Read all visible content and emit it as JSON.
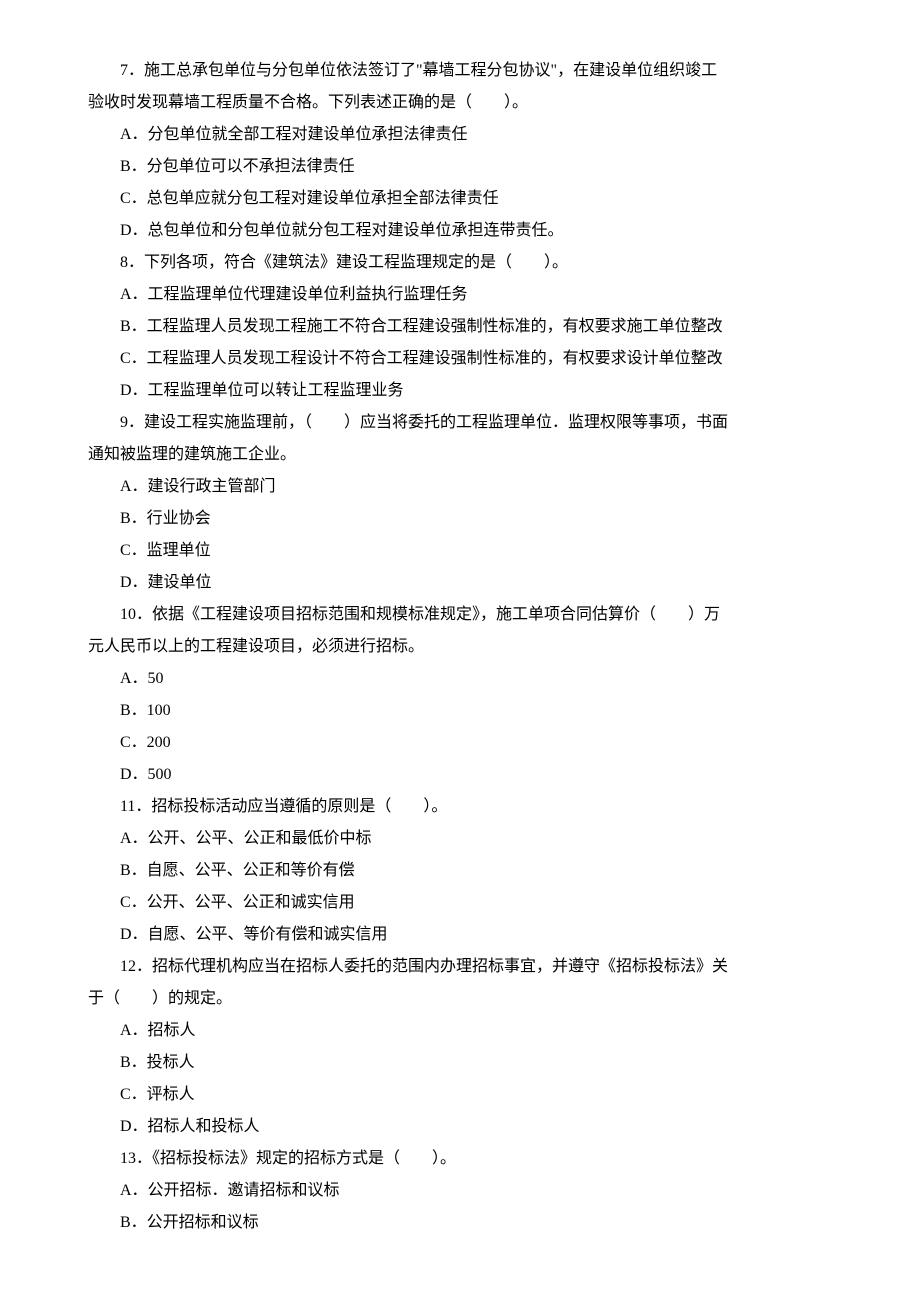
{
  "lines": [
    {
      "text": "7．施工总承包单位与分包单位依法签订了\"幕墙工程分包协议\"，在建设单位组织竣工",
      "indent": true
    },
    {
      "text": "验收时发现幕墙工程质量不合格。下列表述正确的是（　　）。",
      "indent": false
    },
    {
      "text": "A．分包单位就全部工程对建设单位承担法律责任",
      "indent": true
    },
    {
      "text": "B．分包单位可以不承担法律责任",
      "indent": true
    },
    {
      "text": "C．总包单应就分包工程对建设单位承担全部法律责任",
      "indent": true
    },
    {
      "text": "D．总包单位和分包单位就分包工程对建设单位承担连带责任。",
      "indent": true
    },
    {
      "text": "8．下列各项，符合《建筑法》建设工程监理规定的是（　　）。",
      "indent": true
    },
    {
      "text": "A．工程监理单位代理建设单位利益执行监理任务",
      "indent": true
    },
    {
      "text": "B．工程监理人员发现工程施工不符合工程建设强制性标准的，有权要求施工单位整改",
      "indent": true
    },
    {
      "text": "C．工程监理人员发现工程设计不符合工程建设强制性标准的，有权要求设计单位整改",
      "indent": true
    },
    {
      "text": "D．工程监理单位可以转让工程监理业务",
      "indent": true
    },
    {
      "text": "9．建设工程实施监理前，（　　）应当将委托的工程监理单位．监理权限等事项，书面",
      "indent": true
    },
    {
      "text": "通知被监理的建筑施工企业。",
      "indent": false
    },
    {
      "text": "A．建设行政主管部门",
      "indent": true
    },
    {
      "text": "B．行业协会",
      "indent": true
    },
    {
      "text": "C．监理单位",
      "indent": true
    },
    {
      "text": "D．建设单位",
      "indent": true
    },
    {
      "text": "10．依据《工程建设项目招标范围和规模标准规定》，施工单项合同估算价（　　）万",
      "indent": true
    },
    {
      "text": "元人民币以上的工程建设项目，必须进行招标。",
      "indent": false
    },
    {
      "text": "A．50",
      "indent": true
    },
    {
      "text": "B．100",
      "indent": true
    },
    {
      "text": "C．200",
      "indent": true
    },
    {
      "text": "D．500",
      "indent": true
    },
    {
      "text": "11．招标投标活动应当遵循的原则是（　　）。",
      "indent": true
    },
    {
      "text": "A．公开、公平、公正和最低价中标",
      "indent": true
    },
    {
      "text": "B．自愿、公平、公正和等价有偿",
      "indent": true
    },
    {
      "text": "C．公开、公平、公正和诚实信用",
      "indent": true
    },
    {
      "text": "D．自愿、公平、等价有偿和诚实信用",
      "indent": true
    },
    {
      "text": "12．招标代理机构应当在招标人委托的范围内办理招标事宜，并遵守《招标投标法》关",
      "indent": true
    },
    {
      "text": "于（　　）的规定。",
      "indent": false
    },
    {
      "text": "A．招标人",
      "indent": true
    },
    {
      "text": "B．投标人",
      "indent": true
    },
    {
      "text": "C．评标人",
      "indent": true
    },
    {
      "text": "D．招标人和投标人",
      "indent": true
    },
    {
      "text": "13．《招标投标法》规定的招标方式是（　　）。",
      "indent": true
    },
    {
      "text": "A．公开招标．邀请招标和议标",
      "indent": true
    },
    {
      "text": "B．公开招标和议标",
      "indent": true
    }
  ]
}
